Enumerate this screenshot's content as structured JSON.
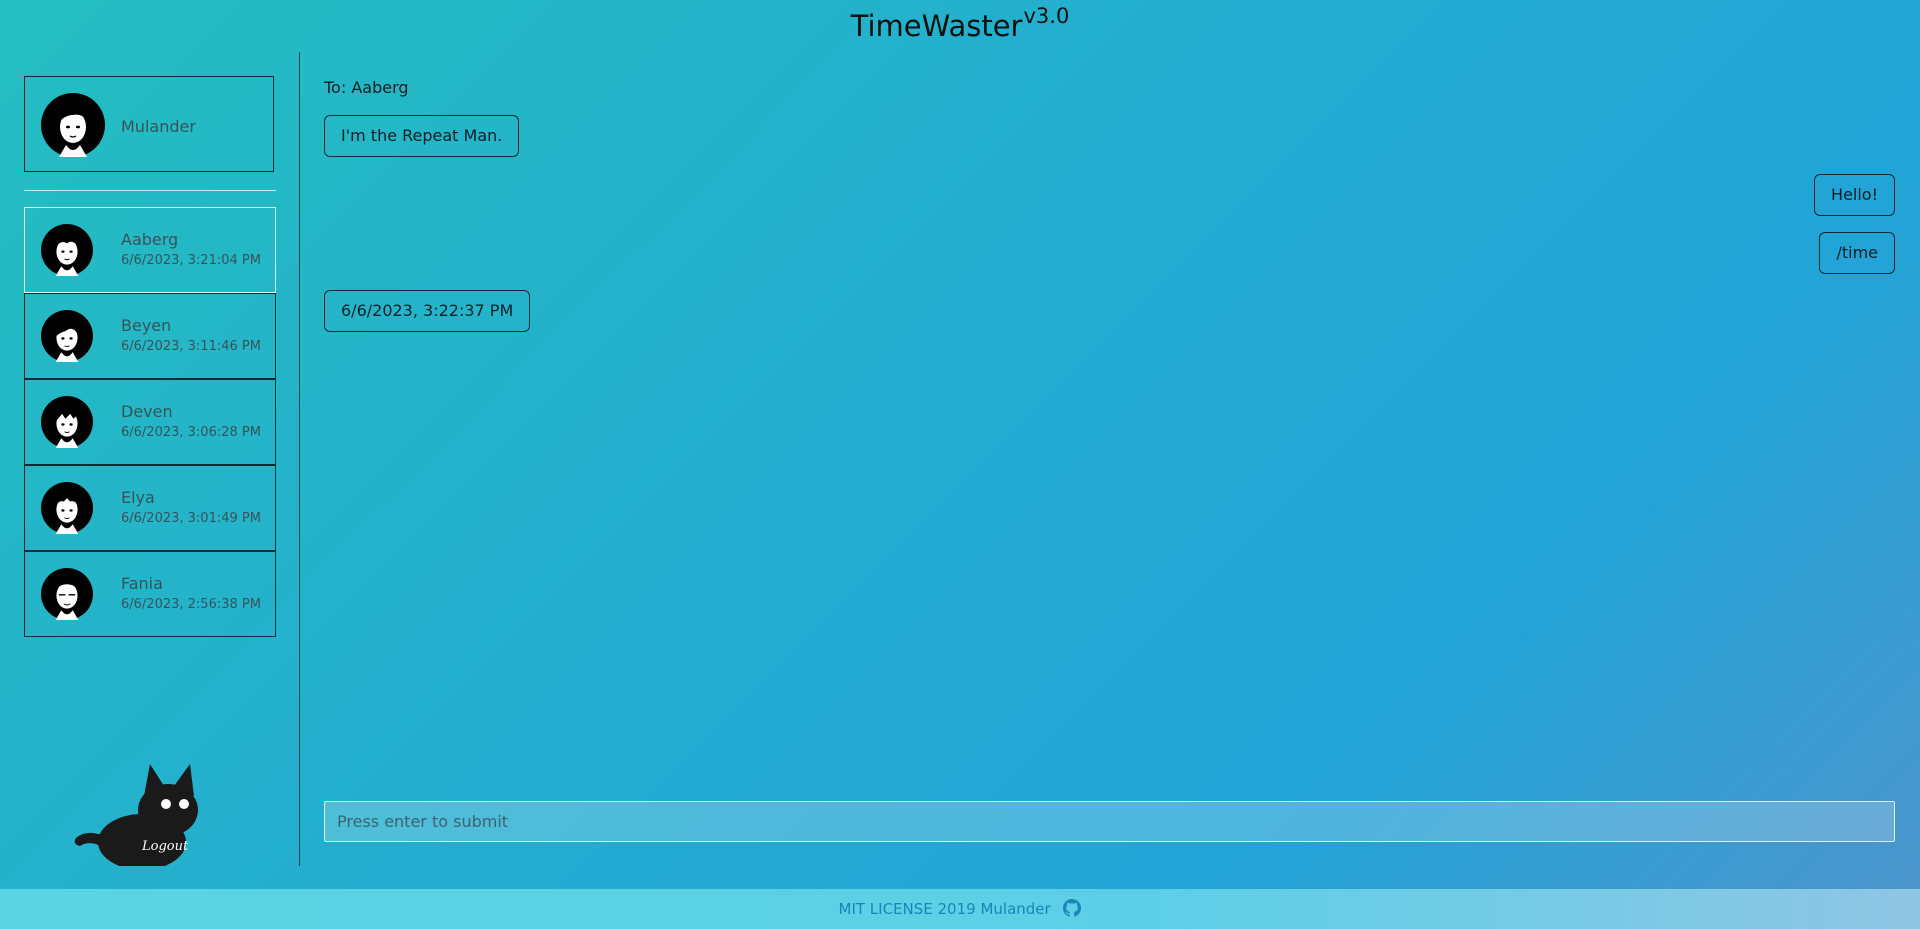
{
  "app": {
    "title": "TimeWaster",
    "version": "v3.0"
  },
  "current_user": {
    "name": "Mulander"
  },
  "contacts": [
    {
      "name": "Aaberg",
      "time": "6/6/2023, 3:21:04 PM",
      "active": true
    },
    {
      "name": "Beyen",
      "time": "6/6/2023, 3:11:46 PM"
    },
    {
      "name": "Deven",
      "time": "6/6/2023, 3:06:28 PM"
    },
    {
      "name": "Elya",
      "time": "6/6/2023, 3:01:49 PM"
    },
    {
      "name": "Fania",
      "time": "6/6/2023, 2:56:38 PM"
    }
  ],
  "logout": {
    "label": "Logout"
  },
  "chat": {
    "to_label": "To: Aaberg",
    "messages": [
      {
        "text": "I'm the Repeat Man.",
        "side": "left"
      },
      {
        "text": "Hello!",
        "side": "right"
      },
      {
        "text": "/time",
        "side": "right"
      },
      {
        "text": "6/6/2023, 3:22:37 PM",
        "side": "left"
      }
    ],
    "input_placeholder": "Press enter to submit"
  },
  "footer": {
    "text": "MIT LICENSE 2019 Mulander",
    "icon": "github-icon"
  },
  "colors": {
    "border": "#0f2a30",
    "active_border": "#e6fbfc",
    "footer_text": "#1a86b7"
  }
}
